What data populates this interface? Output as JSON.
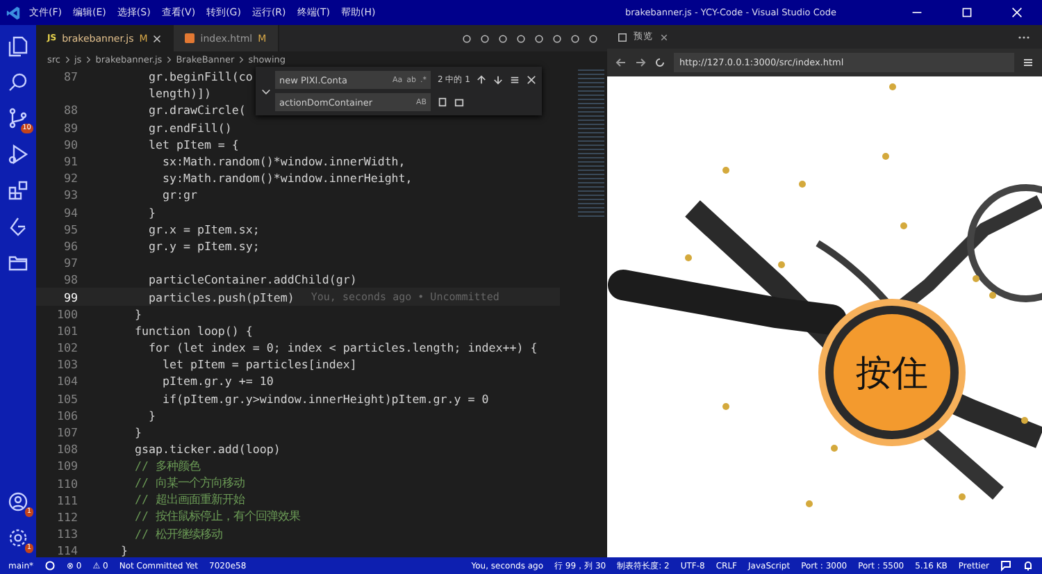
{
  "window": {
    "title": "brakebanner.js - YCY-Code - Visual Studio Code"
  },
  "menu": [
    "文件(F)",
    "编辑(E)",
    "选择(S)",
    "查看(V)",
    "转到(G)",
    "运行(R)",
    "终端(T)",
    "帮助(H)"
  ],
  "activity_bar": [
    {
      "kind": "explorer",
      "selected": false
    },
    {
      "kind": "search",
      "selected": false
    },
    {
      "kind": "git",
      "selected": false,
      "badge": "10"
    },
    {
      "kind": "debug",
      "selected": false
    },
    {
      "kind": "extensions",
      "selected": false
    },
    {
      "kind": "remote",
      "selected": false
    },
    {
      "kind": "folder",
      "selected": false
    }
  ],
  "activity_bottom": [
    {
      "kind": "account",
      "badge": "1"
    },
    {
      "kind": "settings",
      "badge": "1"
    }
  ],
  "tabs": [
    {
      "label": "brakebanner.js",
      "status": "M",
      "badge": "JS",
      "selected": true
    },
    {
      "label": "index.html",
      "status": "M",
      "selected": false
    }
  ],
  "breadcrumb": [
    "src",
    "js",
    "brakebanner.js",
    "BrakeBanner",
    "showing"
  ],
  "find_widget": {
    "find": "new PIXI.Conta",
    "replace": "actionDomContainer",
    "options": [
      "Aa",
      "ab",
      ".*"
    ],
    "replace_option": "AB",
    "result": "2 中的 1"
  },
  "code": [
    {
      "num": "87",
      "text": "    gr.beginFill(co",
      "kind": "code"
    },
    {
      "text": "    length)])",
      "kind": "code"
    },
    {
      "num": "88",
      "text": "    gr.drawCircle(",
      "kind": "code"
    },
    {
      "num": "89",
      "text": "    gr.endFill()",
      "kind": "code"
    },
    {
      "num": "90",
      "text": "    let pItem = {",
      "kind": "code"
    },
    {
      "num": "91",
      "text": "      sx:Math.random()*window.innerWidth,",
      "kind": "code"
    },
    {
      "num": "92",
      "text": "      sy:Math.random()*window.innerHeight,",
      "kind": "code"
    },
    {
      "num": "93",
      "text": "      gr:gr",
      "kind": "code"
    },
    {
      "num": "94",
      "text": "    }",
      "kind": "code"
    },
    {
      "num": "95",
      "text": "    gr.x = pItem.sx;",
      "kind": "code"
    },
    {
      "num": "96",
      "text": "    gr.y = pItem.sy;",
      "kind": "code"
    },
    {
      "num": "97"
    },
    {
      "num": "98",
      "text": "    particleContainer.addChild(gr)",
      "kind": "code"
    },
    {
      "num": "99",
      "text": "    particles.push(pItem)",
      "kind": "code",
      "blame": "You, seconds ago • Uncommitted",
      "current": true
    },
    {
      "num": "100",
      "text": "  }",
      "kind": "code"
    },
    {
      "num": "101",
      "text": "  function loop() {",
      "kind": "code"
    },
    {
      "num": "102",
      "text": "    for (let index = 0; index < particles.length; index++) {",
      "kind": "code"
    },
    {
      "num": "103",
      "text": "      let pItem = particles[index]",
      "kind": "code"
    },
    {
      "num": "104",
      "text": "      pItem.gr.y += 10",
      "kind": "code"
    },
    {
      "num": "105",
      "text": "      if(pItem.gr.y>window.innerHeight)pItem.gr.y = 0",
      "kind": "code"
    },
    {
      "num": "106",
      "text": "    }",
      "kind": "code"
    },
    {
      "num": "107",
      "text": "  }",
      "kind": "code"
    },
    {
      "num": "108",
      "text": "  gsap.ticker.add(loop)",
      "kind": "code"
    },
    {
      "num": "109",
      "text": "  // 多种颜色",
      "kind": "comment"
    },
    {
      "num": "110",
      "text": "  // 向某一个方向移动",
      "kind": "comment"
    },
    {
      "num": "111",
      "text": "  // 超出画面重新开始",
      "kind": "comment"
    },
    {
      "num": "112",
      "text": "  // 按住鼠标停止，有个回弹效果",
      "kind": "comment"
    },
    {
      "num": "113",
      "text": "  // 松开继续移动",
      "kind": "comment"
    },
    {
      "num": "114",
      "text": "}",
      "kind": "code"
    }
  ],
  "browser": {
    "tab": "预览",
    "url": "http://127.0.0.1:3000/src/index.html",
    "button": "按住"
  },
  "status_bar": {
    "branch": "main*",
    "errors": "⊗ 0",
    "warnings": "⚠ 0",
    "left": [
      "Not Committed Yet",
      "7020e58"
    ],
    "right": [
      "You, seconds ago",
      "行 99，列 30",
      "制表符长度: 2",
      "UTF-8",
      "CRLF",
      "JavaScript",
      "Port : 3000",
      "Port : 5500",
      "5.16 KB",
      "Prettier"
    ]
  }
}
